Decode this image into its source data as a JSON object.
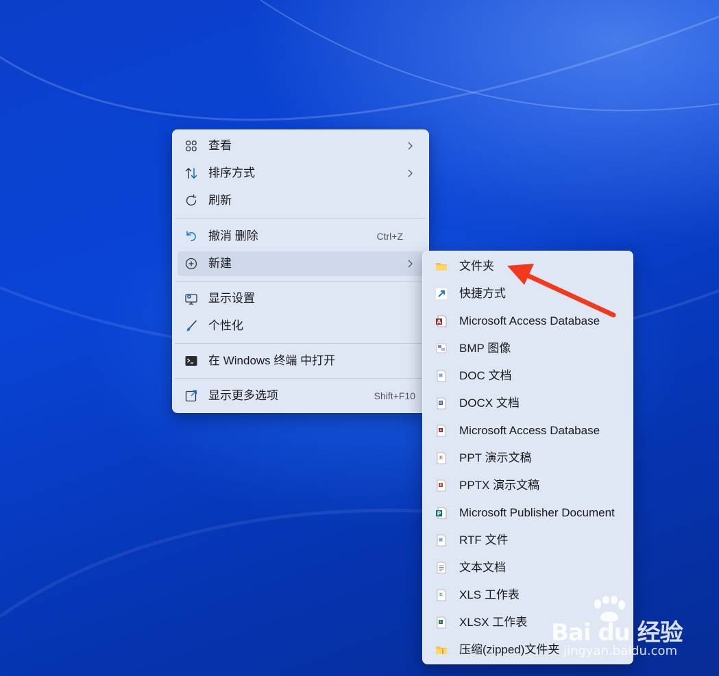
{
  "main_menu": {
    "items": [
      {
        "label": "查看",
        "icon": "grid-view-icon",
        "submenu": true
      },
      {
        "label": "排序方式",
        "icon": "sort-icon",
        "submenu": true
      },
      {
        "label": "刷新",
        "icon": "refresh-icon"
      },
      {
        "label": "撤消 删除",
        "icon": "undo-icon",
        "shortcut": "Ctrl+Z"
      },
      {
        "label": "新建",
        "icon": "new-plus-icon",
        "submenu": true,
        "highlighted": true
      },
      {
        "label": "显示设置",
        "icon": "display-settings-icon"
      },
      {
        "label": "个性化",
        "icon": "brush-icon"
      },
      {
        "label": "在 Windows 终端 中打开",
        "icon": "terminal-icon"
      },
      {
        "label": "显示更多选项",
        "icon": "show-more-icon",
        "shortcut": "Shift+F10"
      }
    ]
  },
  "new_submenu": {
    "items": [
      {
        "label": "文件夹",
        "icon": "folder-icon"
      },
      {
        "label": "快捷方式",
        "icon": "shortcut-icon"
      },
      {
        "label": "Microsoft Access Database",
        "icon": "access-icon"
      },
      {
        "label": "BMP 图像",
        "icon": "bmp-icon"
      },
      {
        "label": "DOC 文档",
        "icon": "doc-icon"
      },
      {
        "label": "DOCX 文档",
        "icon": "docx-icon"
      },
      {
        "label": "Microsoft Access Database",
        "icon": "access-file-icon"
      },
      {
        "label": "PPT 演示文稿",
        "icon": "ppt-icon"
      },
      {
        "label": "PPTX 演示文稿",
        "icon": "pptx-icon"
      },
      {
        "label": "Microsoft Publisher Document",
        "icon": "publisher-icon"
      },
      {
        "label": "RTF 文件",
        "icon": "rtf-icon"
      },
      {
        "label": "文本文档",
        "icon": "text-file-icon"
      },
      {
        "label": "XLS 工作表",
        "icon": "xls-icon"
      },
      {
        "label": "XLSX 工作表",
        "icon": "xlsx-icon"
      },
      {
        "label": "压缩(zipped)文件夹",
        "icon": "zip-folder-icon"
      }
    ]
  },
  "annotation": {
    "arrow_color": "#f0391e",
    "points_to": "文件夹"
  },
  "watermark": {
    "brand": "Bai du 经验",
    "url": "jingyan.baidu.com"
  },
  "colors": {
    "menu_bg": "#dfe6f4",
    "highlight": "#cfd8ea",
    "accent": "#0067c0"
  }
}
